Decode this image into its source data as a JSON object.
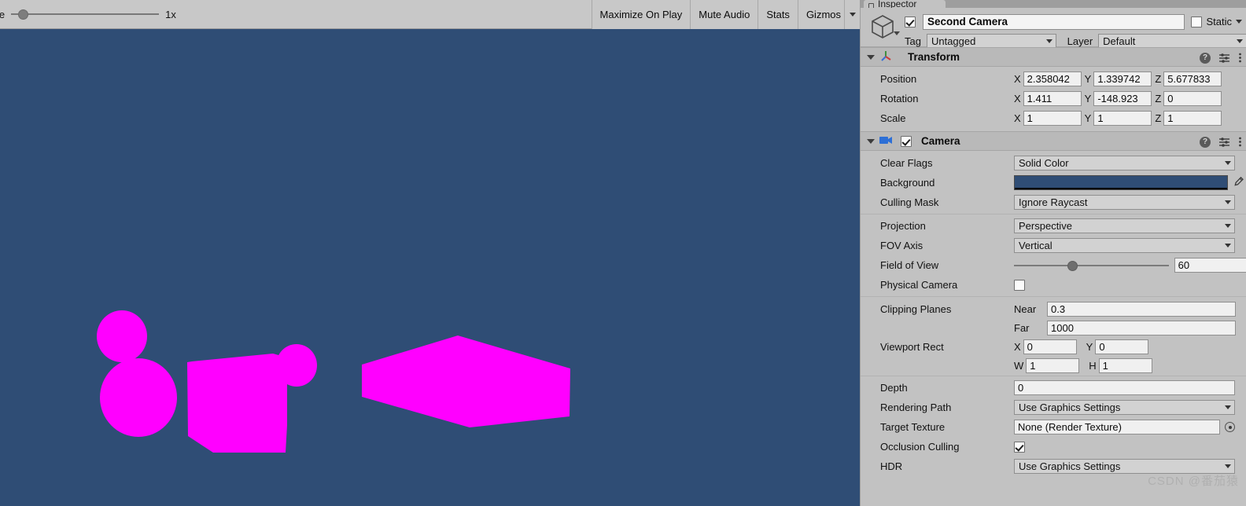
{
  "game_view": {
    "toolbar": {
      "scale_label": "le",
      "scale_value": "1x",
      "buttons": [
        "Maximize On Play",
        "Mute Audio",
        "Stats",
        "Gizmos"
      ],
      "maximize_label": "Maximize On Play",
      "mute_label": "Mute Audio",
      "stats_label": "Stats",
      "gizmos_label": "Gizmos"
    },
    "background_color": "#2f4d75",
    "object_color": "#ff00ff"
  },
  "inspector": {
    "tab_label": "Inspector",
    "object": {
      "enabled": true,
      "name": "Second Camera",
      "static_label": "Static",
      "static_checked": false,
      "tag_label": "Tag",
      "tag_value": "Untagged",
      "layer_label": "Layer",
      "layer_value": "Default"
    },
    "transform": {
      "title": "Transform",
      "rows": [
        {
          "label": "Position",
          "x": "2.358042",
          "y": "1.339742",
          "z": "5.677833"
        },
        {
          "label": "Rotation",
          "x": "1.411",
          "y": "-148.923",
          "z": "0"
        },
        {
          "label": "Scale",
          "x": "1",
          "y": "1",
          "z": "1"
        }
      ],
      "axis_x": "X",
      "axis_y": "Y",
      "axis_z": "Z"
    },
    "camera": {
      "title": "Camera",
      "enabled": true,
      "clear_flags_label": "Clear Flags",
      "clear_flags_value": "Solid Color",
      "background_label": "Background",
      "background_color": "#2f4d75",
      "culling_mask_label": "Culling Mask",
      "culling_mask_value": "Ignore Raycast",
      "projection_label": "Projection",
      "projection_value": "Perspective",
      "fov_axis_label": "FOV Axis",
      "fov_axis_value": "Vertical",
      "fov_label": "Field of View",
      "fov_value": "60",
      "physical_camera_label": "Physical Camera",
      "physical_camera_checked": false,
      "clipping_label": "Clipping Planes",
      "near_label": "Near",
      "near_value": "0.3",
      "far_label": "Far",
      "far_value": "1000",
      "viewport_label": "Viewport Rect",
      "viewport_x_label": "X",
      "viewport_x": "0",
      "viewport_y_label": "Y",
      "viewport_y": "0",
      "viewport_w_label": "W",
      "viewport_w": "1",
      "viewport_h_label": "H",
      "viewport_h": "1",
      "depth_label": "Depth",
      "depth_value": "0",
      "rendering_path_label": "Rendering Path",
      "rendering_path_value": "Use Graphics Settings",
      "target_texture_label": "Target Texture",
      "target_texture_value": "None (Render Texture)",
      "occlusion_label": "Occlusion Culling",
      "occlusion_checked": true,
      "hdr_label": "HDR",
      "hdr_value": "Use Graphics Settings"
    }
  },
  "watermark": "CSDN @番茄猿"
}
